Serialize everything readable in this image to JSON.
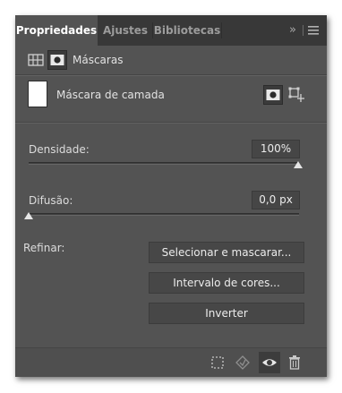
{
  "tabs": [
    {
      "label": "Propriedades",
      "active": true
    },
    {
      "label": "Ajustes",
      "active": false
    },
    {
      "label": "Bibliotecas",
      "active": false
    }
  ],
  "tabbar": {
    "expand_glyph": "»",
    "menu_icon": "menu-icon"
  },
  "mask_panel": {
    "title": "Máscaras",
    "layer_label": "Máscara de camada",
    "icons": [
      "pixel-mask-icon",
      "vector-mask-icon",
      "add-pixel-mask-icon",
      "add-vector-mask-icon"
    ]
  },
  "density": {
    "label": "Densidade:",
    "value": "100%",
    "fraction": 1.0
  },
  "feather": {
    "label": "Difusão:",
    "value": "0,0 px",
    "fraction": 0.0
  },
  "refine": {
    "label": "Refinar:",
    "buttons": [
      "Selecionar e mascarar...",
      "Intervalo de cores...",
      "Inverter"
    ]
  },
  "bottom_icons": [
    "load-selection-icon",
    "apply-mask-icon",
    "visibility-eye-icon",
    "trash-icon"
  ],
  "colors": {
    "panel": "#535353",
    "tabbar": "#383838",
    "accent_text": "#ffffff"
  }
}
